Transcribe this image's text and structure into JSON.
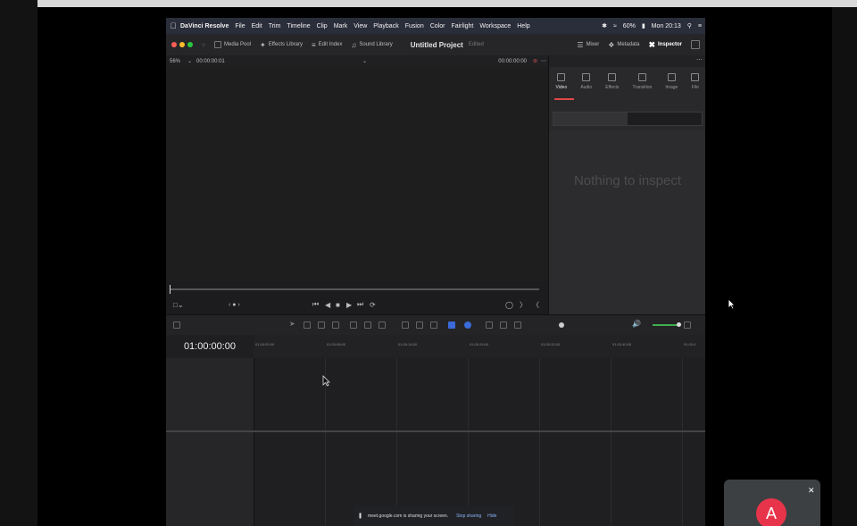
{
  "menubar": {
    "app_name": "DaVinci Resolve",
    "items": [
      "File",
      "Edit",
      "Trim",
      "Timeline",
      "Clip",
      "Mark",
      "View",
      "Playback",
      "Fusion",
      "Color",
      "Fairlight",
      "Workspace",
      "Help"
    ],
    "battery": "60%",
    "clock": "Mon 20:13"
  },
  "toolbar": {
    "media_pool": "Media Pool",
    "effects_library": "Effects Library",
    "edit_index": "Edit Index",
    "sound_library": "Sound Library",
    "project_title": "Untitled Project",
    "edited": "Edited",
    "mixer": "Mixer",
    "metadata": "Metadata",
    "inspector": "Inspector"
  },
  "viewer": {
    "zoom": "56%",
    "timecode_left": "00:00:00:01",
    "timecode_right": "00:00:00:00"
  },
  "inspector": {
    "tabs": [
      "Video",
      "Audio",
      "Effects",
      "Transition",
      "Image",
      "File"
    ],
    "empty_message": "Nothing to inspect"
  },
  "timeline": {
    "timecode": "01:00:00:00",
    "ruler": [
      "01:00:00:00",
      "01:00:08:00",
      "01:00:16:00",
      "01:00:24:00",
      "01:00:32:00",
      "01:00:40:00",
      "01:00:4"
    ]
  },
  "share_bar": {
    "message": "meet.google.com is sharing your screen.",
    "stop": "Stop sharing",
    "hide": "Hide"
  },
  "participant": {
    "initial": "A"
  },
  "colors": {
    "accent_red": "#e04848",
    "volume_green": "#3fae4c",
    "avatar": "#e8344a",
    "traffic_red": "#ff5f57",
    "traffic_yellow": "#febc2e",
    "traffic_green": "#28c840"
  }
}
